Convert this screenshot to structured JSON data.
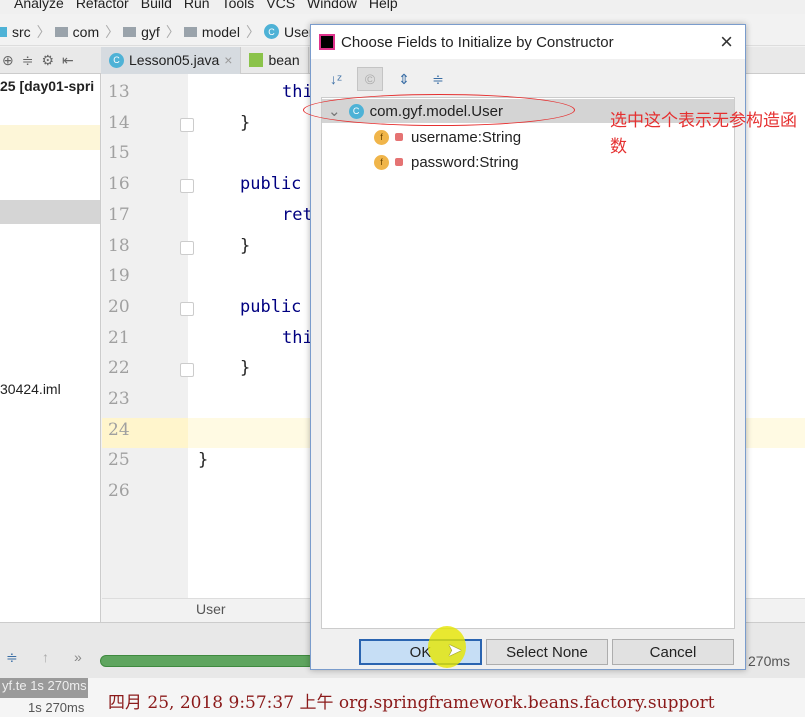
{
  "menu": [
    "Analyze",
    "Refactor",
    "Build",
    "Run",
    "Tools",
    "VCS",
    "Window",
    "Help"
  ],
  "breadcrumb": [
    "src",
    "com",
    "gyf",
    "model",
    "User"
  ],
  "tabs": [
    "Lesson05.java",
    "bean"
  ],
  "left_panel": {
    "project_label": "25 [day01-spri",
    "iml_file": "30424.iml"
  },
  "editor": {
    "line_numbers": [
      "13",
      "14",
      "15",
      "16",
      "17",
      "18",
      "19",
      "20",
      "21",
      "22",
      "23",
      "24",
      "25",
      "26"
    ],
    "lines": [
      {
        "n": 13,
        "text": "thi",
        "indent": 2
      },
      {
        "n": 14,
        "text": "}",
        "indent": 1
      },
      {
        "n": 16,
        "text": "public",
        "indent": 1
      },
      {
        "n": 17,
        "text": "ret",
        "indent": 2
      },
      {
        "n": 18,
        "text": "}",
        "indent": 1
      },
      {
        "n": 20,
        "text": "public",
        "indent": 1
      },
      {
        "n": 21,
        "text": "thi",
        "indent": 2
      },
      {
        "n": 22,
        "text": "}",
        "indent": 1
      },
      {
        "n": 25,
        "text": "}",
        "indent": 0
      }
    ],
    "current_line": "24",
    "bottom_breadcrumb": "User"
  },
  "dialog": {
    "title": "Choose Fields to Initialize by Constructor",
    "close": "×",
    "tree": {
      "root": "com.gyf.model.User",
      "fields": [
        "username:String",
        "password:String"
      ]
    },
    "buttons": {
      "ok": "OK",
      "select_none": "Select None",
      "cancel": "Cancel"
    }
  },
  "annotation": "选中这个表示无参构造函数",
  "run": {
    "time_right": "270ms",
    "left_item": "yf.te",
    "left_time": "1s 270ms",
    "left_time2": "1s 270ms",
    "progress_color": "#5fa55f"
  },
  "console": {
    "line": "四月 25, 2018 9:57:37 上午 org.springframework.beans.factory.support"
  },
  "colors": {
    "annotation": "#e53030",
    "keyword": "#000080",
    "highlight_line": "#fffae3"
  }
}
